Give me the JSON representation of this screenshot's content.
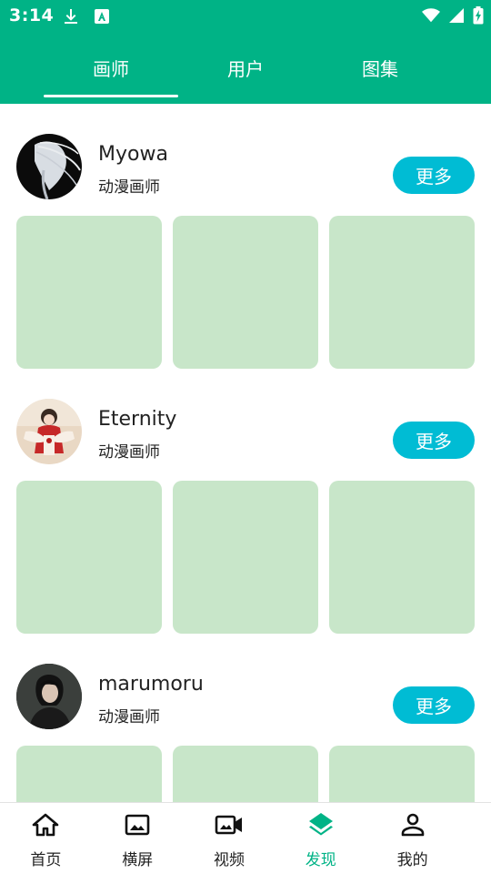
{
  "status_bar": {
    "time": "3:14",
    "left_icons": [
      "download-icon",
      "text-a-icon"
    ],
    "right_icons": [
      "wifi-icon",
      "cell-signal-icon",
      "battery-charging-icon"
    ]
  },
  "colors": {
    "primary": "#00b386",
    "button": "#00bcd4",
    "placeholder": "#c8e6c9",
    "text": "#222222"
  },
  "tabs": [
    {
      "label": "画师",
      "selected": true
    },
    {
      "label": "用户",
      "selected": false
    },
    {
      "label": "图集",
      "selected": false
    }
  ],
  "artists": [
    {
      "name": "Myowa",
      "role": "动漫画师",
      "more_label": "更多"
    },
    {
      "name": "Eternity",
      "role": "动漫画师",
      "more_label": "更多"
    },
    {
      "name": "marumoru",
      "role": "动漫画师",
      "more_label": "更多"
    }
  ],
  "bottom_nav": [
    {
      "label": "首页",
      "icon": "home-icon",
      "active": false
    },
    {
      "label": "横屏",
      "icon": "image-icon",
      "active": false
    },
    {
      "label": "视频",
      "icon": "video-camera-icon",
      "active": false
    },
    {
      "label": "发现",
      "icon": "layers-icon",
      "active": true
    },
    {
      "label": "我的",
      "icon": "person-icon",
      "active": false
    }
  ]
}
